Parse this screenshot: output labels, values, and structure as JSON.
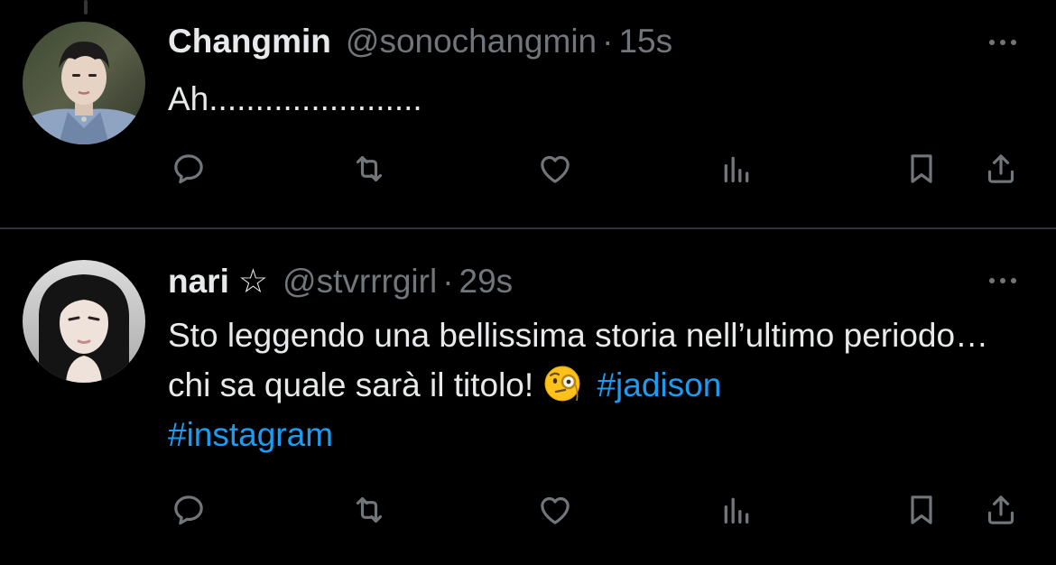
{
  "colors": {
    "background": "#000000",
    "primary_text": "#e7e9ea",
    "secondary_text": "#71767b",
    "link": "#1d9bf0",
    "divider": "#2f3336"
  },
  "tweets": [
    {
      "display_name": "Changmin",
      "badge": "",
      "handle": "@sonochangmin",
      "separator": "·",
      "time": "15s",
      "text": "Ah.......................",
      "icons": [
        "reply-icon",
        "retweet-icon",
        "like-icon",
        "views-icon",
        "bookmark-icon",
        "share-icon",
        "more-icon"
      ]
    },
    {
      "display_name": "nari",
      "badge": "☆",
      "handle": "@stvrrrgirl",
      "separator": "·",
      "time": "29s",
      "text_part1": "Sto leggendo una bellissima storia nell’ultimo periodo…chi sa quale sarà il titolo! ",
      "emoji": "face-with-monocle",
      "hashtag_1": "#jadison",
      "hashtag_2": "#instagram",
      "icons": [
        "reply-icon",
        "retweet-icon",
        "like-icon",
        "views-icon",
        "bookmark-icon",
        "share-icon",
        "more-icon"
      ]
    }
  ]
}
